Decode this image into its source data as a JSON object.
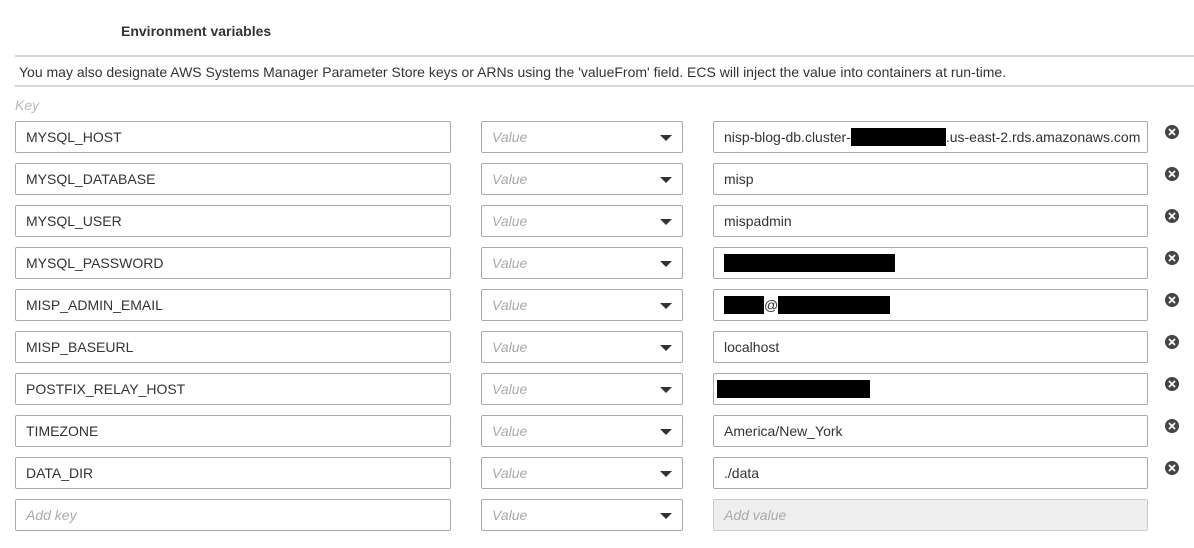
{
  "section": {
    "title": "Environment variables",
    "info": "You may also designate AWS Systems Manager Parameter Store keys or ARNs using the 'valueFrom' field. ECS will inject the value into containers at run-time.",
    "key_header": "Key"
  },
  "rows": [
    {
      "key": "MYSQL_HOST",
      "type_placeholder": "Value",
      "value_prefix": "nisp-blog-db.cluster-",
      "value_suffix": ".us-east-2.rds.amazonaws.com"
    },
    {
      "key": "MYSQL_DATABASE",
      "type_placeholder": "Value",
      "value": "misp"
    },
    {
      "key": "MYSQL_USER",
      "type_placeholder": "Value",
      "value": "mispadmin"
    },
    {
      "key": "MYSQL_PASSWORD",
      "type_placeholder": "Value",
      "value": ""
    },
    {
      "key": "MISP_ADMIN_EMAIL",
      "type_placeholder": "Value",
      "value_mid": "@"
    },
    {
      "key": "MISP_BASEURL",
      "type_placeholder": "Value",
      "value": "localhost"
    },
    {
      "key": "POSTFIX_RELAY_HOST",
      "type_placeholder": "Value",
      "value": ""
    },
    {
      "key": "TIMEZONE",
      "type_placeholder": "Value",
      "value": "America/New_York"
    },
    {
      "key": "DATA_DIR",
      "type_placeholder": "Value",
      "value": "./data"
    }
  ],
  "new_row": {
    "key_placeholder": "Add key",
    "type_placeholder": "Value",
    "value_placeholder": "Add value"
  },
  "colors": {
    "border": "#aaaaaa",
    "redaction": "#000000",
    "disabled_bg": "#eeeeee"
  }
}
